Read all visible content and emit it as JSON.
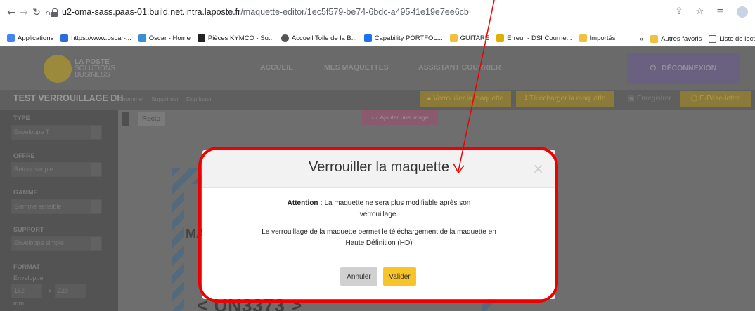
{
  "browser": {
    "url_host": "u2-oma-sass.paas-01.build.net.intra.laposte.fr",
    "url_path": "/maquette-editor/1ec5f579-be74-6bdc-a495-f1e19e7ee6cb",
    "bookmarks": [
      {
        "label": "Applications",
        "color": "#4285f4"
      },
      {
        "label": "https://www.oscar-...",
        "color": "#2a6fd6"
      },
      {
        "label": "Oscar - Home",
        "color": "#3a8fd0"
      },
      {
        "label": "Pièces KYMCO - Su...",
        "color": "#222222"
      },
      {
        "label": "Accueil Toile de la B...",
        "color": "#555555"
      },
      {
        "label": "Capability PORTFOL...",
        "color": "#1a73e8"
      },
      {
        "label": "GUITARE",
        "color": "#f0c040"
      },
      {
        "label": "Erreur - DSI Courrie...",
        "color": "#e0b000"
      },
      {
        "label": "Importés",
        "color": "#f0c040"
      }
    ],
    "overflow": "»",
    "other_favorites": "Autres favoris",
    "reading_list": "Liste de lect"
  },
  "app": {
    "logo_text": [
      "LA POSTE",
      "SOLUTIONS",
      "BUSINESS"
    ],
    "nav": [
      "ACCUEIL",
      "MES MAQUETTES",
      "ASSISTANT COURRIER"
    ],
    "logout": "DÉCONNEXION",
    "doc_title": "TEST VERROUILLAGE DH",
    "doc_actions": [
      "Renommer",
      "Supprimer",
      "Dupliquer"
    ],
    "toolbar": {
      "lock": "Verrouiller la maquette",
      "download": "Télécharger la maquette",
      "save": "Enregistrer",
      "pese": "E-Pèse-lettre"
    },
    "sidebar": {
      "type_label": "TYPE",
      "type_value": "Enveloppe T",
      "offre_label": "OFFRE",
      "offre_value": "Retour simple",
      "gamme_label": "GAMME",
      "gamme_value": "Gamme sensible",
      "support_label": "SUPPORT",
      "support_value": "Enveloppe simple",
      "format_label": "FORMAT",
      "format_sub": "Enveloppe",
      "width": "162",
      "x": "x",
      "height": "229",
      "unit": "mm"
    },
    "recto_tab": "Recto",
    "add_image": "Ajouter une image",
    "envelope_text": "MA",
    "un_code": "< UN3373 >"
  },
  "modal": {
    "title": "Verrouiller la maquette",
    "close": "×",
    "attention_label": "Attention :",
    "attention_text": "La maquette ne sera plus modifiable après son verrouillage.",
    "info_text": "Le verrouillage de la maquette permet le téléchargement de la maquette en Haute Définition (HD)",
    "cancel": "Annuler",
    "confirm": "Valider"
  },
  "annotation": {
    "frame_color": "#ee0000"
  }
}
